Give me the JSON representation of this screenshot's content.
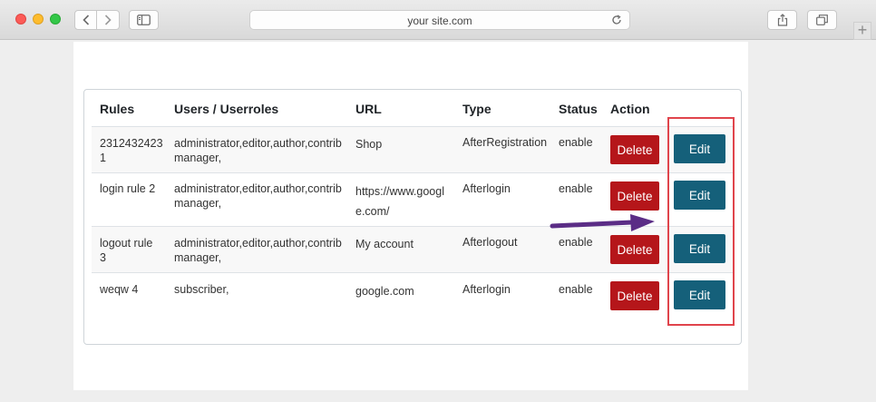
{
  "browser": {
    "address": "your site.com"
  },
  "table": {
    "headers": {
      "rules": "Rules",
      "users": "Users / Userroles",
      "url": "URL",
      "type": "Type",
      "status": "Status",
      "action": "Action"
    },
    "rows": [
      {
        "rule_line1": "2312432423",
        "rule_line2": "1",
        "users_line1": "administrator,editor,author,contribu",
        "users_line2": "manager,",
        "url_line1": "Shop",
        "url_line2": "",
        "type": "AfterRegistration",
        "status": "enable",
        "delete_label": "Delete",
        "edit_label": "Edit"
      },
      {
        "rule_line1": "login rule 2",
        "rule_line2": "",
        "users_line1": "administrator,editor,author,contribu",
        "users_line2": "manager,",
        "url_line1": "https://www.googl",
        "url_line2": "e.com/",
        "type": "Afterlogin",
        "status": "enable",
        "delete_label": "Delete",
        "edit_label": "Edit"
      },
      {
        "rule_line1": "logout rule",
        "rule_line2": "3",
        "users_line1": "administrator,editor,author,contribu",
        "users_line2": "manager,",
        "url_line1": "My account",
        "url_line2": "",
        "type": "Afterlogout",
        "status": "enable",
        "delete_label": "Delete",
        "edit_label": "Edit"
      },
      {
        "rule_line1": "weqw 4",
        "rule_line2": "",
        "users_line1": "subscriber,",
        "users_line2": "",
        "url_line1": "google.com",
        "url_line2": "",
        "type": "Afterlogin",
        "status": "enable",
        "delete_label": "Delete",
        "edit_label": "Edit"
      }
    ]
  },
  "colors": {
    "delete": "#b5161a",
    "edit": "#15607a",
    "highlight": "#e0444c",
    "arrow": "#5b2d86"
  }
}
